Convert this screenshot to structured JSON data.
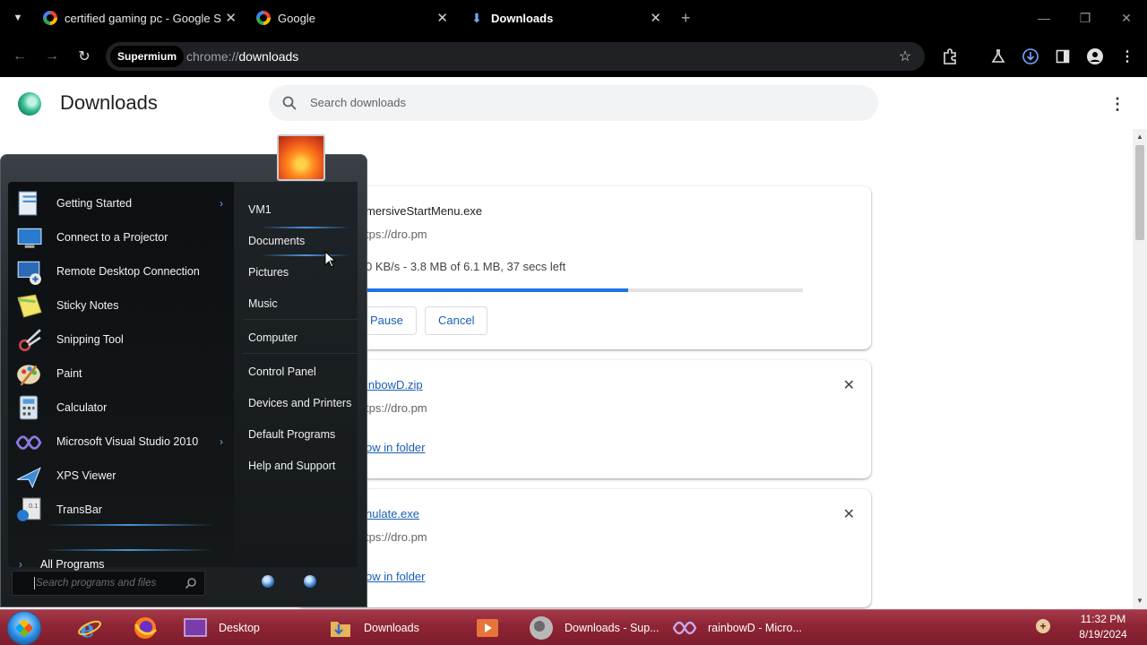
{
  "browser": {
    "tabs": [
      {
        "label": "certified gaming pc - Google S",
        "icon": "google-icon",
        "active": false
      },
      {
        "label": "Google",
        "icon": "google-icon",
        "active": false
      },
      {
        "label": "Downloads",
        "icon": "download-icon",
        "active": true
      }
    ],
    "new_tab_symbol": "+",
    "site_chip": "Supermium",
    "url_scheme": "chrome://",
    "url_path": "downloads"
  },
  "downloads_page": {
    "title": "Downloads",
    "search_placeholder": "Search downloads",
    "items": [
      {
        "name": "mersiveStartMenu.exe",
        "url": "tps://dro.pm",
        "status": "0 KB/s - 3.8 MB of 6.1 MB, 37 secs left",
        "progress_fraction": 0.6,
        "buttons": [
          "Pause",
          "Cancel"
        ]
      },
      {
        "name": "inbowD.zip",
        "url": "tps://dro.pm",
        "link": "ow in folder"
      },
      {
        "name": "nulate.exe",
        "url": "tps://dro.pm",
        "link": "ow in folder"
      }
    ]
  },
  "start_menu": {
    "programs": [
      {
        "label": "Getting Started",
        "icon": "getting-started-icon",
        "submenu": true
      },
      {
        "label": "Connect to a Projector",
        "icon": "projector-icon",
        "submenu": false
      },
      {
        "label": "Remote Desktop Connection",
        "icon": "remote-desktop-icon",
        "submenu": false
      },
      {
        "label": "Sticky Notes",
        "icon": "sticky-notes-icon",
        "submenu": false
      },
      {
        "label": "Snipping Tool",
        "icon": "snipping-tool-icon",
        "submenu": false
      },
      {
        "label": "Paint",
        "icon": "paint-icon",
        "submenu": false
      },
      {
        "label": "Calculator",
        "icon": "calculator-icon",
        "submenu": false
      },
      {
        "label": "Microsoft Visual Studio 2010",
        "icon": "visual-studio-icon",
        "submenu": true
      },
      {
        "label": "XPS Viewer",
        "icon": "xps-viewer-icon",
        "submenu": false
      },
      {
        "label": "TransBar",
        "icon": "transbar-icon",
        "submenu": false
      }
    ],
    "all_programs": "All Programs",
    "places": [
      "VM1",
      "Documents",
      "Pictures",
      "Music",
      "Computer",
      "Control Panel",
      "Devices and Printers",
      "Default Programs",
      "Help and Support"
    ],
    "search_placeholder": "Search programs and files"
  },
  "taskbar": {
    "items": [
      {
        "label": "",
        "icon": "internet-explorer-icon"
      },
      {
        "label": "",
        "icon": "firefox-icon"
      },
      {
        "label": "Desktop",
        "icon": "desktop-icon"
      },
      {
        "label": "Downloads",
        "icon": "folder-icon"
      },
      {
        "label": "",
        "icon": "media-player-icon"
      },
      {
        "label": "Downloads - Sup...",
        "icon": "supermium-icon"
      },
      {
        "label": "rainbowD - Micro...",
        "icon": "visual-studio-icon"
      }
    ],
    "time": "11:32 PM",
    "date": "8/19/2024"
  }
}
